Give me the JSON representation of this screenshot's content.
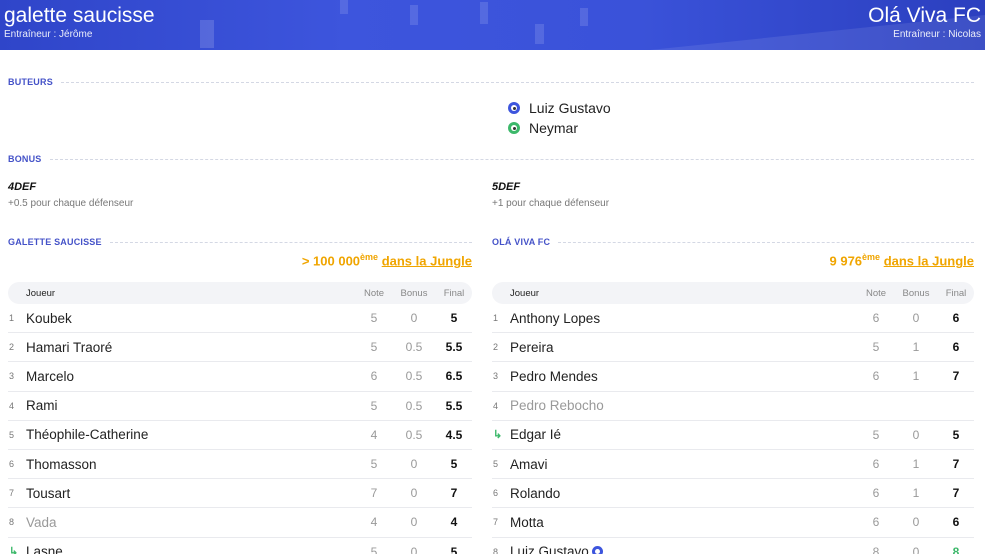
{
  "header": {
    "home": {
      "name": "galette saucisse",
      "coach": "Entraîneur : Jérôme"
    },
    "away": {
      "name": "Olá Viva FC",
      "coach": "Entraîneur : Nicolas"
    }
  },
  "sections": {
    "scorers": "BUTEURS",
    "bonus": "BONUS",
    "home_team": "GALETTE SAUCISSE",
    "away_team": "OLÁ VIVA FC"
  },
  "scorers": [
    {
      "name": "Luiz Gustavo",
      "icon": "soccer-ball-blue-icon"
    },
    {
      "name": "Neymar",
      "icon": "soccer-ball-green-icon"
    }
  ],
  "bonus": {
    "home": {
      "name": "4DEF",
      "desc": "+0.5 pour chaque défenseur"
    },
    "away": {
      "name": "5DEF",
      "desc": "+1 pour chaque défenseur"
    }
  },
  "ranking": {
    "home": {
      "rank": "> 100 000",
      "sup": "ème",
      "link": "dans la Jungle"
    },
    "away": {
      "rank": "9 976",
      "sup": "ème",
      "link": "dans la Jungle"
    }
  },
  "table_headers": {
    "player": "Joueur",
    "note": "Note",
    "bonus": "Bonus",
    "final": "Final"
  },
  "home_players": [
    {
      "idx": "1",
      "name": "Koubek",
      "note": "5",
      "bonus": "0",
      "final": "5"
    },
    {
      "idx": "2",
      "name": "Hamari Traoré",
      "note": "5",
      "bonus": "0.5",
      "final": "5.5"
    },
    {
      "idx": "3",
      "name": "Marcelo",
      "note": "6",
      "bonus": "0.5",
      "final": "6.5"
    },
    {
      "idx": "4",
      "name": "Rami",
      "note": "5",
      "bonus": "0.5",
      "final": "5.5"
    },
    {
      "idx": "5",
      "name": "Théophile-Catherine",
      "note": "4",
      "bonus": "0.5",
      "final": "4.5"
    },
    {
      "idx": "6",
      "name": "Thomasson",
      "note": "5",
      "bonus": "0",
      "final": "5"
    },
    {
      "idx": "7",
      "name": "Tousart",
      "note": "7",
      "bonus": "0",
      "final": "7"
    },
    {
      "idx": "8",
      "name": "Vada",
      "note": "4",
      "bonus": "0",
      "final": "4",
      "muted": true
    },
    {
      "idx": "",
      "name": "Lasne",
      "note": "5",
      "bonus": "0",
      "final": "5",
      "sub": true
    }
  ],
  "away_players": [
    {
      "idx": "1",
      "name": "Anthony Lopes",
      "note": "6",
      "bonus": "0",
      "final": "6"
    },
    {
      "idx": "2",
      "name": "Pereira",
      "note": "5",
      "bonus": "1",
      "final": "6"
    },
    {
      "idx": "3",
      "name": "Pedro Mendes",
      "note": "6",
      "bonus": "1",
      "final": "7"
    },
    {
      "idx": "4",
      "name": "Pedro Rebocho",
      "note": "",
      "bonus": "",
      "final": "",
      "muted": true
    },
    {
      "idx": "",
      "name": "Edgar Ié",
      "note": "5",
      "bonus": "0",
      "final": "5",
      "sub": true
    },
    {
      "idx": "5",
      "name": "Amavi",
      "note": "6",
      "bonus": "1",
      "final": "7"
    },
    {
      "idx": "6",
      "name": "Rolando",
      "note": "6",
      "bonus": "1",
      "final": "7"
    },
    {
      "idx": "7",
      "name": "Motta",
      "note": "6",
      "bonus": "0",
      "final": "6"
    },
    {
      "idx": "8",
      "name": "Luiz Gustavo",
      "note": "8",
      "bonus": "0",
      "final": "8",
      "goal": true,
      "green": true
    }
  ],
  "colors": {
    "header": "#3a52d9",
    "accent": "#4452c8",
    "rank": "#f0a500",
    "green": "#3cb86a"
  }
}
